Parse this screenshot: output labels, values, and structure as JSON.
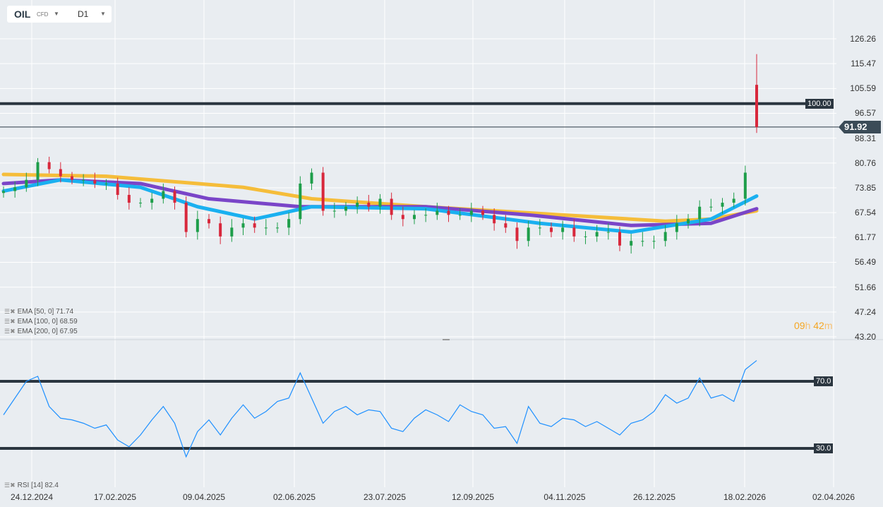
{
  "toolbar": {
    "symbol": "OIL",
    "type": "CFD",
    "timeframe": "D1"
  },
  "price_axis": [
    "126.26",
    "115.47",
    "105.59",
    "96.57",
    "88.31",
    "80.76",
    "73.85",
    "67.54",
    "61.77",
    "56.49",
    "51.66",
    "47.24",
    "43.20"
  ],
  "price_axis_values": [
    126.26,
    115.47,
    105.59,
    96.57,
    88.31,
    80.76,
    73.85,
    67.54,
    61.77,
    56.49,
    51.66,
    47.24,
    43.2
  ],
  "level_line": {
    "value": 100.0,
    "label": "100.00"
  },
  "current_price": {
    "value": 91.92,
    "label": "91.92"
  },
  "timer": {
    "h": "09",
    "h_unit": "h",
    "m": "42",
    "m_unit": "m"
  },
  "indicators": [
    {
      "label": "EMA  [50,  0] 71.74",
      "color": "#1ab0f0"
    },
    {
      "label": "EMA  [100,  0] 68.59",
      "color": "#7a45c8"
    },
    {
      "label": "EMA  [200,  0] 67.95",
      "color": "#f5bd3a"
    }
  ],
  "rsi": {
    "label": "RSI  [14] 82.4",
    "levels": [
      {
        "value": 70,
        "label": "70.0"
      },
      {
        "value": 30,
        "label": "30.0"
      }
    ],
    "values": [
      50,
      60,
      70,
      73,
      55,
      48,
      47,
      45,
      42,
      44,
      35,
      31,
      38,
      47,
      55,
      45,
      25,
      40,
      47,
      38,
      48,
      56,
      48,
      52,
      58,
      60,
      75,
      60,
      45,
      52,
      55,
      50,
      53,
      52,
      42,
      40,
      48,
      53,
      50,
      46,
      56,
      52,
      50,
      42,
      43,
      33,
      55,
      45,
      43,
      48,
      47,
      43,
      46,
      42,
      38,
      45,
      47,
      52,
      62,
      57,
      60,
      72,
      60,
      62,
      58,
      77,
      82.4
    ]
  },
  "dates": [
    "24.12.2024",
    "17.02.2025",
    "09.04.2025",
    "02.06.2025",
    "23.07.2025",
    "12.09.2025",
    "04.11.2025",
    "26.12.2025",
    "18.02.2026",
    "02.04.2026"
  ],
  "chart_data": {
    "type": "candlestick",
    "closes": [
      73,
      74,
      76,
      81,
      79,
      77,
      76,
      76,
      75,
      75,
      72,
      70,
      70,
      71,
      73,
      70,
      63,
      66,
      65,
      62,
      64,
      65,
      64,
      64,
      64,
      66,
      75,
      78,
      68,
      68,
      69,
      70,
      69,
      71,
      67,
      66,
      67,
      67,
      68,
      67,
      67,
      68,
      67,
      65,
      64,
      61,
      64,
      64,
      63,
      64,
      62,
      62,
      63,
      63,
      60,
      61,
      61,
      61,
      63,
      65,
      66,
      69,
      69,
      70,
      71,
      78,
      91.92
    ],
    "last_candle": {
      "open": 107,
      "high": 119.5,
      "low": 90,
      "close": 91.92
    },
    "ema200": [
      [
        0,
        77.5
      ],
      [
        9,
        77
      ],
      [
        21,
        74
      ],
      [
        27,
        71
      ],
      [
        37,
        69
      ],
      [
        49,
        67
      ],
      [
        58,
        65.5
      ],
      [
        62,
        66
      ],
      [
        66,
        68
      ]
    ],
    "ema100": [
      [
        0,
        75
      ],
      [
        5,
        76
      ],
      [
        12,
        75
      ],
      [
        18,
        71
      ],
      [
        26,
        69
      ],
      [
        37,
        69
      ],
      [
        46,
        67
      ],
      [
        55,
        64.5
      ],
      [
        62,
        65
      ],
      [
        66,
        68.5
      ]
    ],
    "ema50": [
      [
        0,
        73
      ],
      [
        5,
        76
      ],
      [
        12,
        74
      ],
      [
        17,
        69
      ],
      [
        22,
        66
      ],
      [
        27,
        69
      ],
      [
        37,
        68.5
      ],
      [
        47,
        65
      ],
      [
        55,
        63
      ],
      [
        62,
        66
      ],
      [
        66,
        71.7
      ]
    ],
    "colors": {
      "up": "#1e9e4a",
      "down": "#d8283c"
    }
  }
}
